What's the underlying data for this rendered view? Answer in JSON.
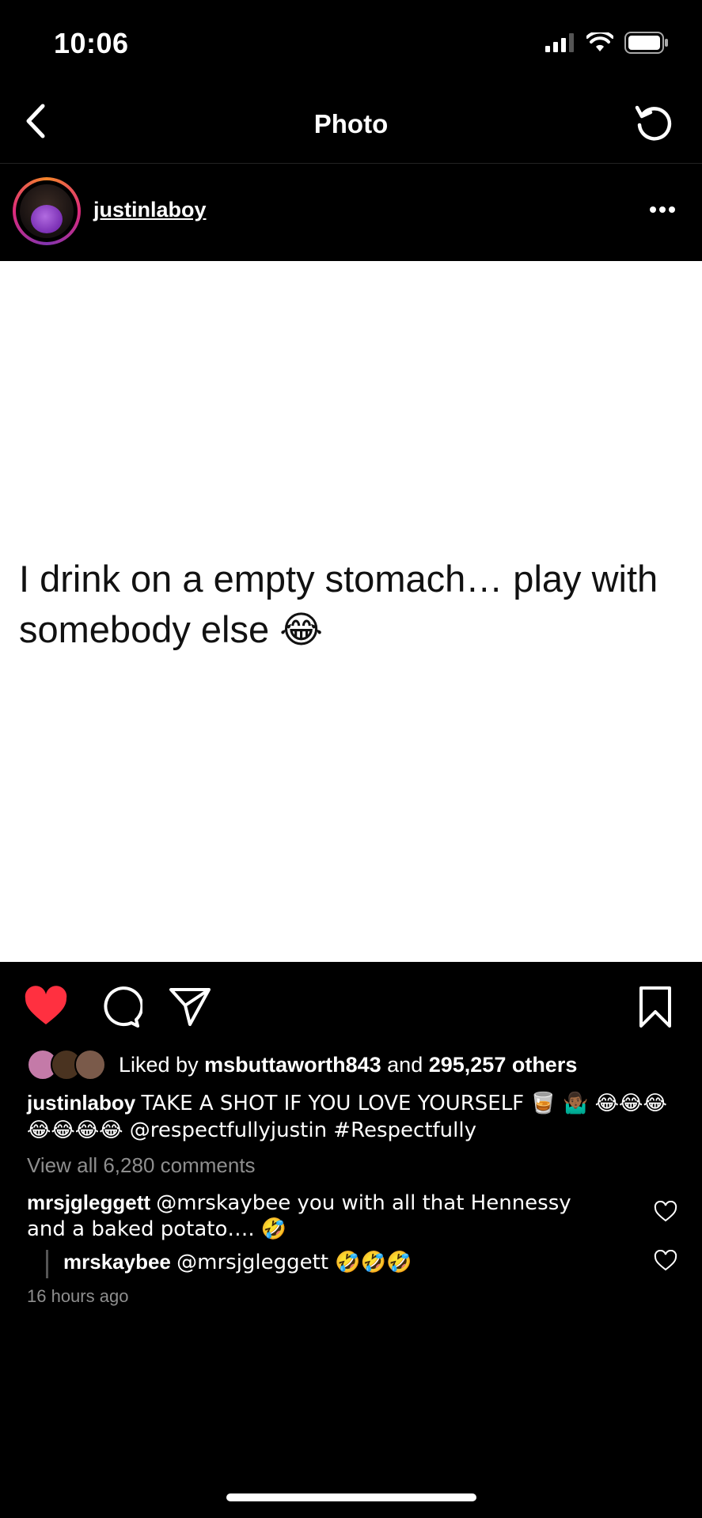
{
  "status": {
    "time": "10:06"
  },
  "nav": {
    "title": "Photo"
  },
  "header": {
    "username": "justinlaboy"
  },
  "photo": {
    "text": "I drink on a empty stomach… play with somebody else 😂"
  },
  "likes": {
    "prefix": "Liked by",
    "user": "msbuttaworth843",
    "and": "and",
    "count": "295,257 others"
  },
  "caption": {
    "user": "justinlaboy",
    "text": "TAKE A SHOT IF YOU LOVE YOURSELF 🥃 🤷🏾‍♂️ 😂😂😂😂😂😂😂 @respectfullyjustin #Respectfully"
  },
  "comments": {
    "view_all": "View all 6,280 comments",
    "items": [
      {
        "user": "mrsjgleggett",
        "text": "@mrskaybee you with all that Hennessy and a baked potato…. 🤣"
      },
      {
        "user": "mrskaybee",
        "text": "@mrsjgleggett 🤣🤣🤣"
      }
    ],
    "time": "16 hours ago"
  },
  "colors": {
    "like_red": "#ff3040",
    "muted": "#8e8e8e",
    "background": "#000000"
  },
  "icons": [
    "back-icon",
    "refresh-icon",
    "more-icon",
    "heart-icon",
    "comment-icon",
    "share-icon",
    "bookmark-icon",
    "heart-outline-icon"
  ]
}
